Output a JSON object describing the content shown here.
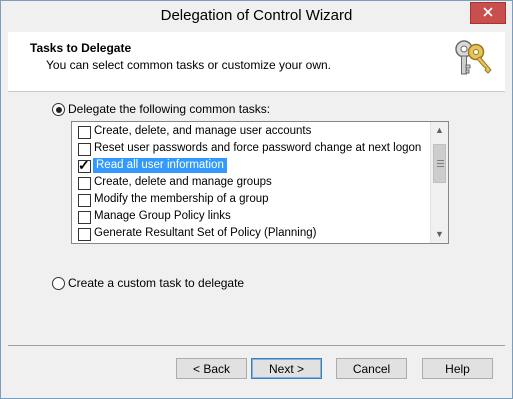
{
  "window": {
    "title": "Delegation of Control Wizard"
  },
  "header": {
    "title": "Tasks to Delegate",
    "subtitle": "You can select common tasks or customize your own.",
    "icon": "keys-icon"
  },
  "options": {
    "common_label": "Delegate the following common tasks:",
    "common_selected": true,
    "custom_label": "Create a custom task to delegate",
    "custom_selected": false
  },
  "tasks": [
    {
      "label": "Create, delete, and manage user accounts",
      "checked": false,
      "selected": false
    },
    {
      "label": "Reset user passwords and force password change at next logon",
      "checked": false,
      "selected": false
    },
    {
      "label": "Read all user information",
      "checked": true,
      "selected": true
    },
    {
      "label": "Create, delete and manage groups",
      "checked": false,
      "selected": false
    },
    {
      "label": "Modify the membership of a group",
      "checked": false,
      "selected": false
    },
    {
      "label": "Manage Group Policy links",
      "checked": false,
      "selected": false
    },
    {
      "label": "Generate Resultant Set of Policy (Planning)",
      "checked": false,
      "selected": false
    }
  ],
  "buttons": {
    "back": "< Back",
    "next": "Next >",
    "cancel": "Cancel",
    "help": "Help"
  },
  "colors": {
    "selection": "#3399ff",
    "close_button": "#c7504d"
  }
}
